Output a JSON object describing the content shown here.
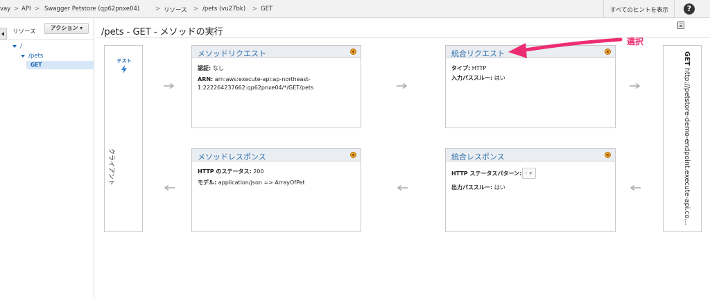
{
  "breadcrumb": {
    "items": [
      "vay",
      "API",
      "Swagger Petstore (qp62pnxe04)",
      "リソース",
      "/pets (vu27bk)",
      "GET"
    ],
    "separator": ">"
  },
  "topbar": {
    "hints_label": "すべてのヒントを表示",
    "help_glyph": "?"
  },
  "sidebar": {
    "title": "リソース",
    "action_button": "アクション ▾",
    "tree": [
      {
        "label": "/",
        "expanded": true
      },
      {
        "label": "/pets",
        "expanded": true
      },
      {
        "label": "GET",
        "selected": true
      }
    ]
  },
  "page": {
    "title": "/pets - GET - メソッドの実行"
  },
  "client": {
    "test_label": "テスト",
    "label": "クライアント"
  },
  "method_request": {
    "title": "メソッドリクエスト",
    "auth_key": "認証:",
    "auth_value": "なし",
    "arn_key": "ARN:",
    "arn_line1": "arn:aws:execute-api:ap-northeast-",
    "arn_line2": "1:222264237662:qp62pnxe04/*/GET/pets"
  },
  "integration_request": {
    "title": "統合リクエスト",
    "type_key": "タイプ:",
    "type_value": "HTTP",
    "passthrough_key": "入力パススルー:",
    "passthrough_value": "はい"
  },
  "method_response": {
    "title": "メソッドレスポンス",
    "status_key": "HTTP のステータス:",
    "status_value": "200",
    "model_key": "モデル:",
    "model_value": "application/json => ArrayOfPet"
  },
  "integration_response": {
    "title": "統合レスポンス",
    "pattern_key": "HTTP ステータスパターン:",
    "pattern_value": "- ÷",
    "passthrough_key": "出力パススルー:",
    "passthrough_value": "はい"
  },
  "endpoint": {
    "method": "GET",
    "url": "http://petstore-demo-endpoint.execute-api.com/..."
  },
  "annotation": {
    "label": "選択",
    "color": "#ec2d72"
  },
  "colors": {
    "panel_title": "#2f6fad",
    "link": "#1a66b3",
    "status_dot": "#f0a030"
  }
}
